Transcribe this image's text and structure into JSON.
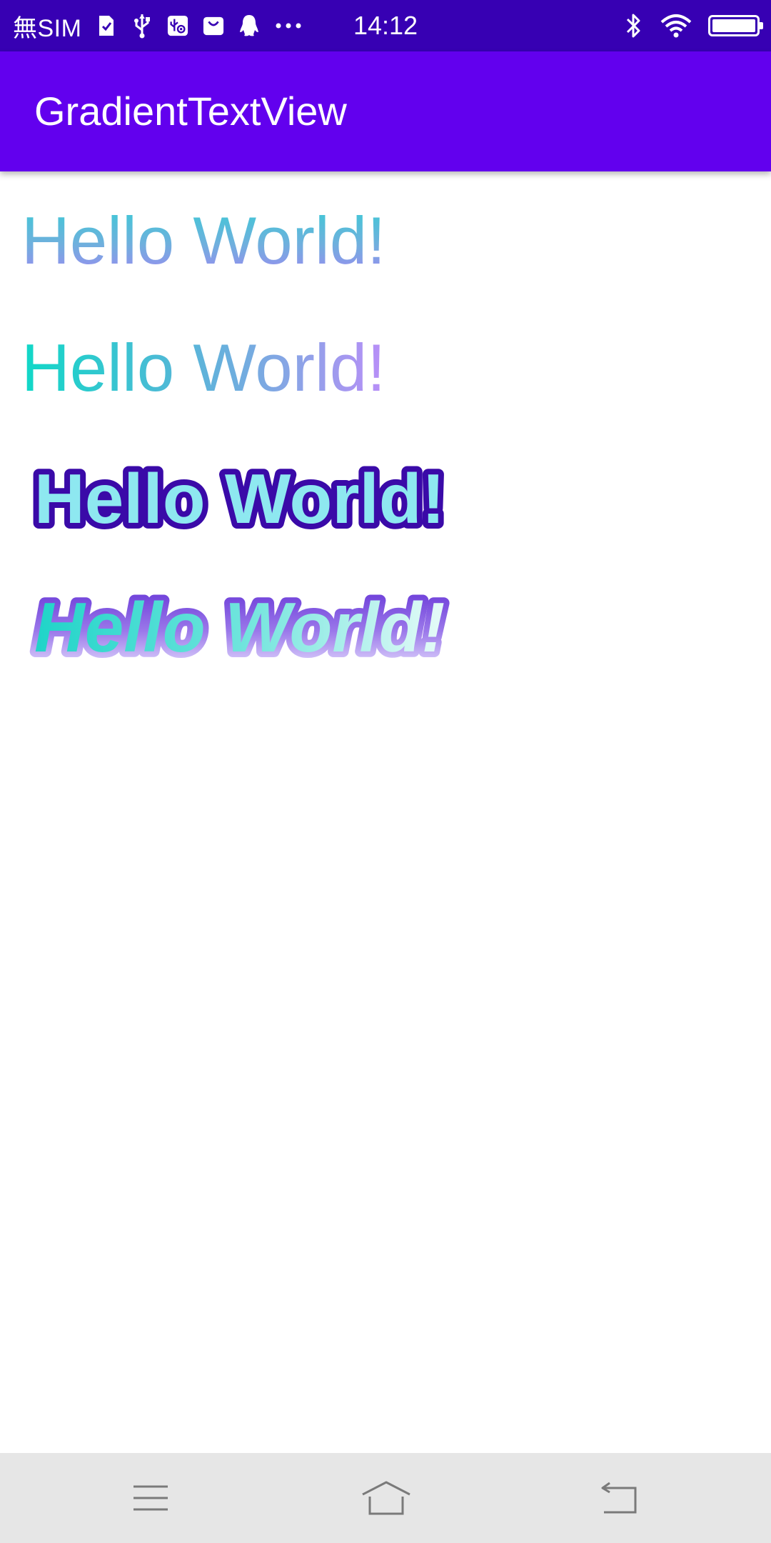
{
  "status_bar": {
    "carrier": "無SIM",
    "time": "14:12",
    "background_color": "#3700b3",
    "left_icons": [
      "sim-card-icon",
      "usb-icon",
      "usb-debug-icon",
      "shopping-bag-icon",
      "qq-penguin-icon",
      "more-dots-icon"
    ],
    "right_icons": [
      "bluetooth-icon",
      "wifi-icon",
      "battery-icon"
    ]
  },
  "app_bar": {
    "title": "GradientTextView",
    "background_color": "#6200ee"
  },
  "content": {
    "samples": [
      {
        "text": "Hello World!",
        "style": "vertical-gradient"
      },
      {
        "text": "Hello World!",
        "style": "horizontal-gradient"
      },
      {
        "text": "Hello World!",
        "style": "bold-stroked-gradient"
      },
      {
        "text": "Hello World!",
        "style": "bold-italic-stroked-gradient"
      }
    ]
  },
  "nav_bar": {
    "background_color": "#e6e6e6",
    "buttons": [
      "menu-icon",
      "home-icon",
      "back-icon"
    ]
  }
}
